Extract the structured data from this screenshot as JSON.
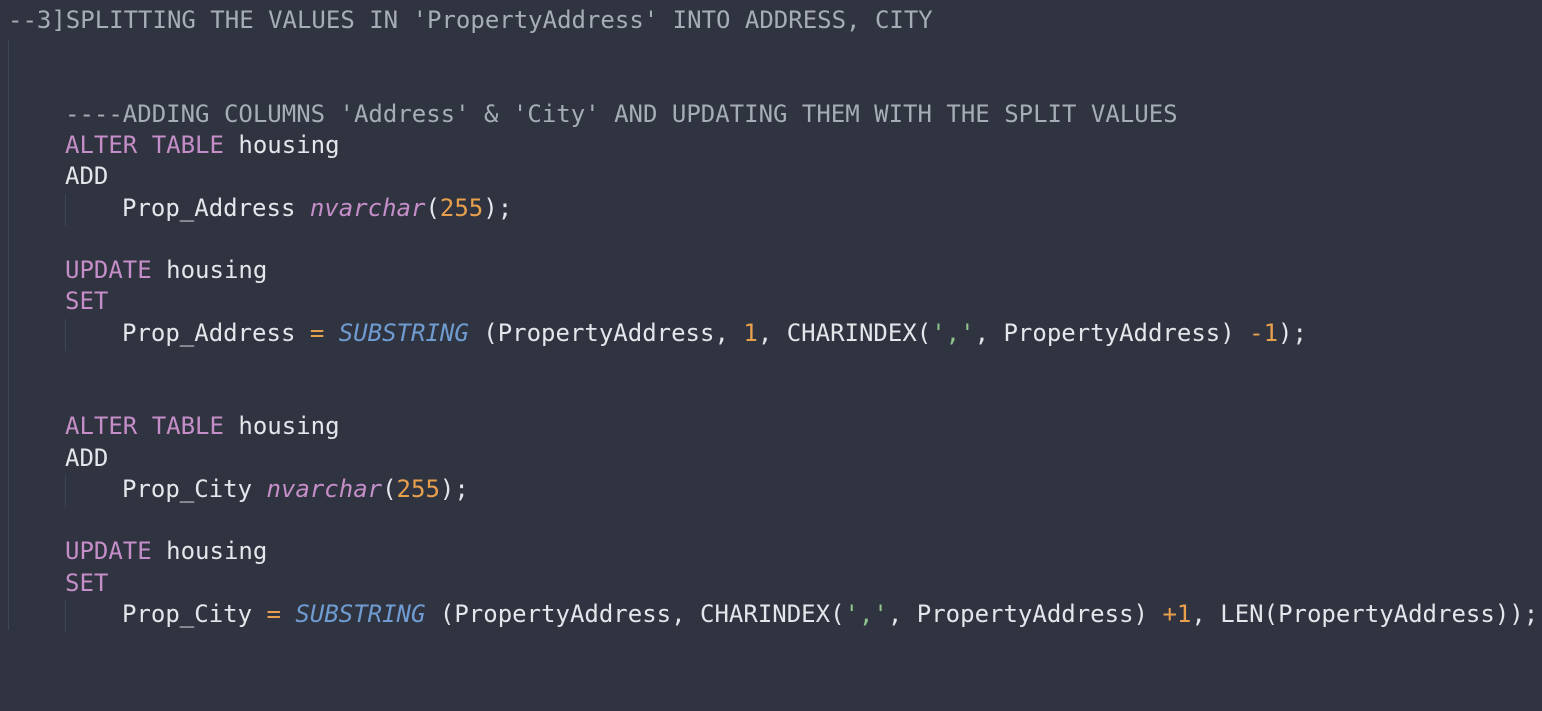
{
  "comments": {
    "header": "--3]SPLITTING THE VALUES IN 'PropertyAddress' INTO ADDRESS, CITY",
    "sub": "----ADDING COLUMNS 'Address' & 'City' AND UPDATING THEM WITH THE SPLIT VALUES"
  },
  "keywords": {
    "alter": "ALTER",
    "table": "TABLE",
    "add": "ADD",
    "update": "UPDATE",
    "set": "SET"
  },
  "identifiers": {
    "table": "housing",
    "prop_address": "Prop_Address",
    "prop_city": "Prop_City",
    "source_col": "PropertyAddress"
  },
  "types": {
    "nvarchar": "nvarchar",
    "size": "255"
  },
  "functions": {
    "substring": "SUBSTRING",
    "charindex": "CHARINDEX",
    "len": "LEN"
  },
  "literals": {
    "one": "1",
    "comma_str": "','",
    "minus": "-",
    "plus": "+",
    "equals": "="
  },
  "colors": {
    "background": "#2f3440",
    "comment": "#a7adb6",
    "keyword": "#c58ec8",
    "function": "#6f9bd1",
    "number": "#e8a04d",
    "string": "#8fc48b",
    "text": "#e3e6ea"
  }
}
